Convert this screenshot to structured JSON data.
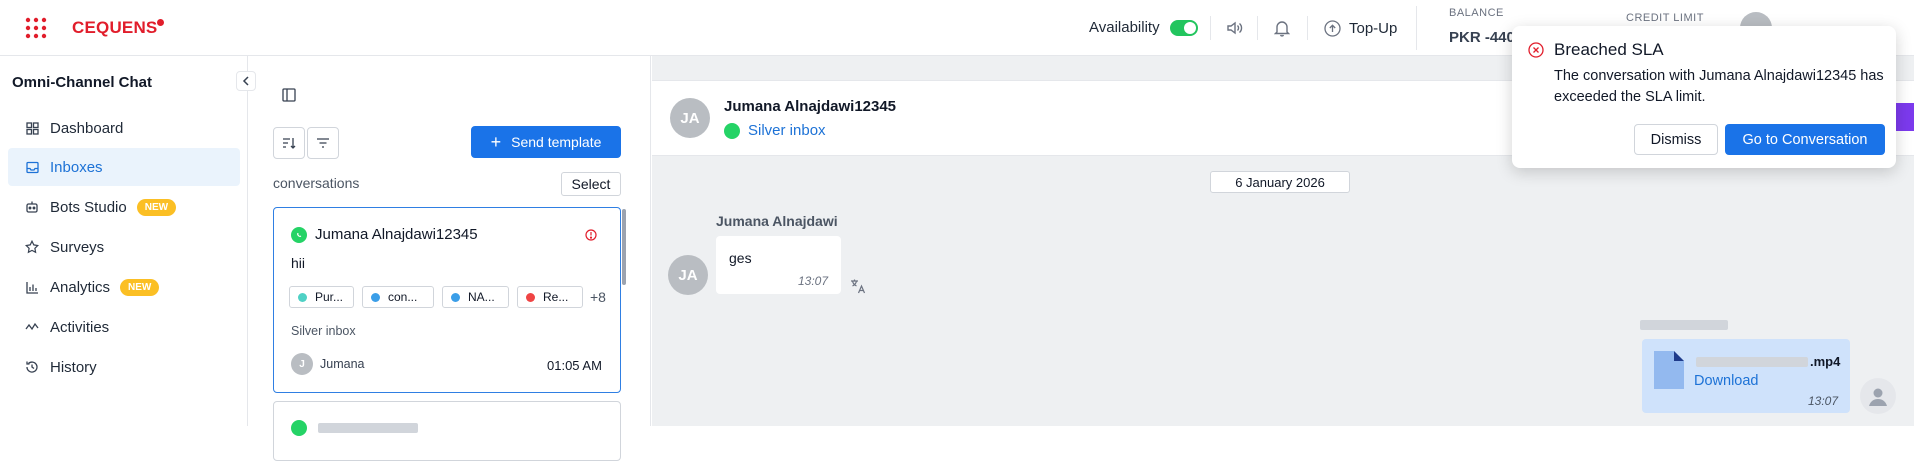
{
  "header": {
    "logo": "CEQUENS",
    "availability_label": "Availability",
    "availability_on": true,
    "topup_label": "Top-Up",
    "balance_label": "BALANCE",
    "balance_value": "PKR -440",
    "credit_limit_label": "CREDIT LIMIT"
  },
  "sidebar": {
    "title": "Omni-Channel Chat",
    "items": [
      {
        "label": "Dashboard",
        "icon": "grid-icon"
      },
      {
        "label": "Inboxes",
        "icon": "inbox-icon",
        "active": true
      },
      {
        "label": "Bots Studio",
        "icon": "bot-icon",
        "badge": "NEW"
      },
      {
        "label": "Surveys",
        "icon": "star-icon"
      },
      {
        "label": "Analytics",
        "icon": "bar-chart-icon",
        "badge": "NEW"
      },
      {
        "label": "Activities",
        "icon": "activity-icon"
      },
      {
        "label": "History",
        "icon": "history-icon"
      }
    ]
  },
  "conversation_list": {
    "send_template_label": "Send template",
    "conversations_label": "conversations",
    "select_label": "Select",
    "cards": [
      {
        "name": "Jumana Alnajdawi12345",
        "preview": "hii",
        "tags": [
          {
            "label": "Pur...",
            "color": "#4fd1c5"
          },
          {
            "label": "con...",
            "color": "#3b9ee8"
          },
          {
            "label": "NA...",
            "color": "#3b9ee8"
          },
          {
            "label": "Re...",
            "color": "#ef4444"
          }
        ],
        "more_tags": "+8",
        "inbox": "Silver inbox",
        "agent_initial": "J",
        "agent": "Jumana",
        "time": "01:05 AM"
      }
    ]
  },
  "chat": {
    "contact_initials": "JA",
    "contact_name": "Jumana Alnajdawi12345",
    "inbox": "Silver inbox",
    "date": "6 January 2026",
    "messages": [
      {
        "sender": "Jumana Alnajdawi",
        "initials": "JA",
        "text": "ges",
        "time": "13:07"
      }
    ],
    "file_message": {
      "extension": ".mp4",
      "download_label": "Download",
      "time": "13:07"
    }
  },
  "toast": {
    "title": "Breached SLA",
    "body": "The conversation with Jumana Alnajdawi12345 has exceeded the SLA limit.",
    "dismiss_label": "Dismiss",
    "goto_label": "Go to Conversation"
  }
}
